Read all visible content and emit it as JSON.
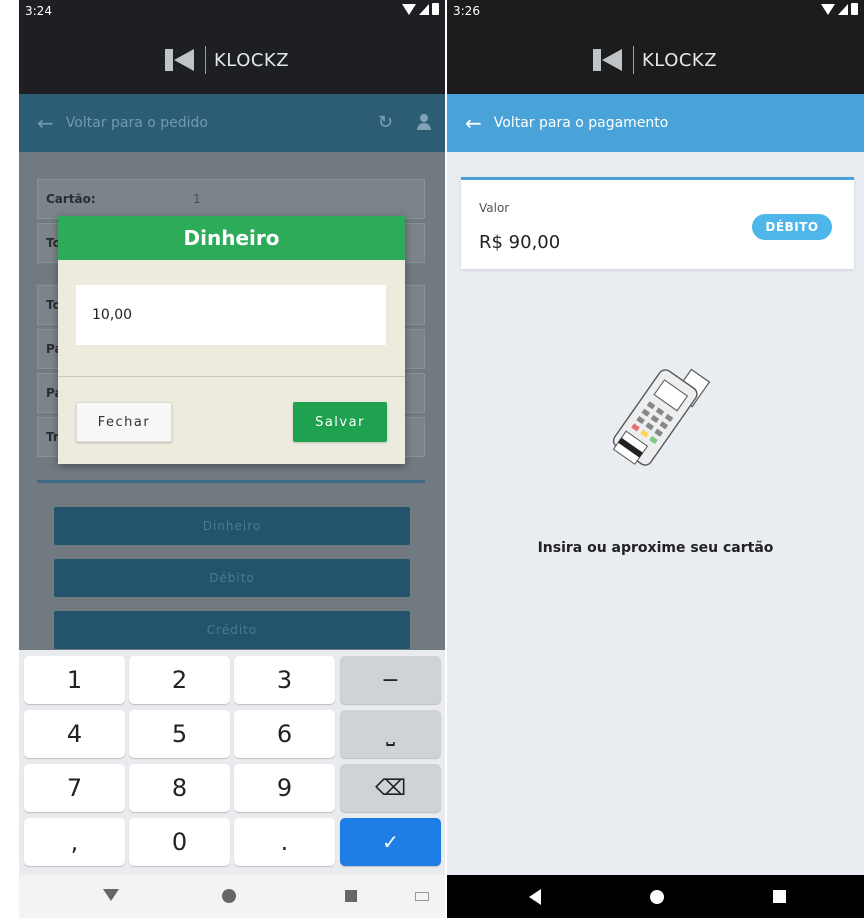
{
  "left": {
    "status_time": "3:24",
    "brand": "KLOCKZ",
    "appbar_title": "Voltar para o pedido",
    "bg_rows": [
      {
        "label": "Cartão:",
        "value": "1"
      },
      {
        "label": "To",
        "value": ""
      },
      {
        "label": "To",
        "value": ""
      },
      {
        "label": "Pa",
        "value": ""
      },
      {
        "label": "Pa",
        "value": ""
      },
      {
        "label": "Tr",
        "value": ""
      }
    ],
    "bg_buttons": [
      "Dinheiro",
      "Débito",
      "Crédito"
    ],
    "dialog": {
      "title": "Dinheiro",
      "input_value": "10,00",
      "close_label": "Fechar",
      "save_label": "Salvar"
    },
    "keypad": {
      "digits": [
        "1",
        "2",
        "3",
        "4",
        "5",
        "6",
        "7",
        "8",
        "9",
        ",",
        "0",
        "."
      ],
      "fn": [
        "−",
        "⎵",
        "⌫"
      ],
      "done": "✓"
    }
  },
  "right": {
    "status_time": "3:26",
    "brand": "KLOCKZ",
    "appbar_title": "Voltar para o pagamento",
    "card": {
      "label": "Valor",
      "amount": "R$ 90,00",
      "badge": "DÉBITO"
    },
    "instruction": "Insira ou aproxime seu cartão"
  },
  "colors": {
    "green": "#2eab59",
    "blue": "#4aa3d8",
    "keyboard_done": "#1f7de6"
  }
}
